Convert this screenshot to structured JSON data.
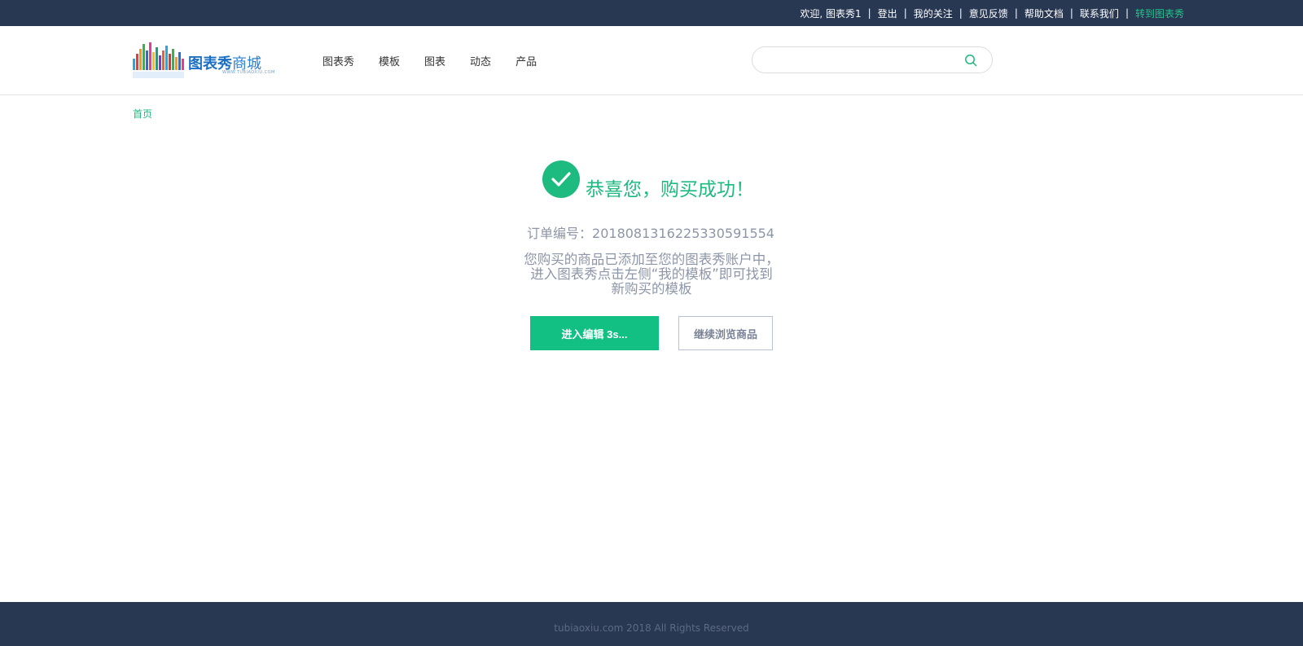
{
  "topbar": {
    "links": [
      {
        "label": "欢迎, 图表秀1",
        "accent": false
      },
      {
        "label": "登出",
        "accent": false
      },
      {
        "label": "我的关注",
        "accent": false
      },
      {
        "label": "意见反馈",
        "accent": false
      },
      {
        "label": "帮助文档",
        "accent": false
      },
      {
        "label": "联系我们",
        "accent": false
      },
      {
        "label": "转到图表秀",
        "accent": true
      }
    ],
    "separator": "|"
  },
  "header": {
    "logo": {
      "main": "图表秀",
      "light": "商城",
      "sub": "WWW.TUBIAOXIU.COM"
    },
    "nav": [
      "图表秀",
      "模板",
      "图表",
      "动态",
      "产品"
    ],
    "search": {
      "value": "",
      "placeholder": ""
    }
  },
  "breadcrumb": "首页",
  "main": {
    "title": "恭喜您，购买成功！",
    "order_label": "订单编号：",
    "order_number": "20180813162253305915​54",
    "desc_line1": "您购买的商品已添加至您的图表秀账户中，",
    "desc_line2": "进入图表秀点击左侧“我的模板”即可找到",
    "desc_line3": "新购买的模板",
    "primary_button": "进入编辑 3s...",
    "secondary_button": "继续浏览商品"
  },
  "footer": {
    "text": "tubiaoxiu.com 2018 All Rights Reserved"
  },
  "colors": {
    "accent": "#1dbb7f",
    "dark_bar": "#283752",
    "muted_text": "#8d96a8"
  }
}
